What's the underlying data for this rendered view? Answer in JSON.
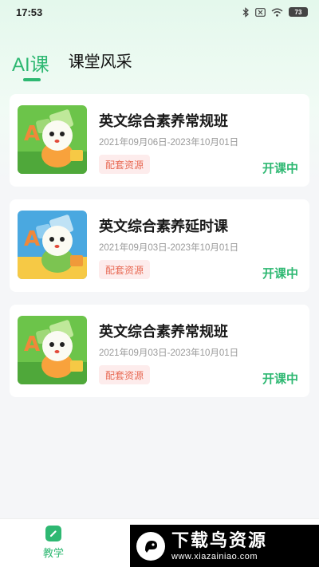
{
  "status_bar": {
    "time": "17:53",
    "battery": "73"
  },
  "tabs": [
    {
      "label": "AI课",
      "active": true
    },
    {
      "label": "课堂风采",
      "active": false
    }
  ],
  "courses": [
    {
      "title": "英文综合素养常规班",
      "date_range": "2021年09月06日-2023年10月01日",
      "resource_label": "配套资源",
      "status": "开课中",
      "thumb_color": "#6cc44a"
    },
    {
      "title": "英文综合素养延时课",
      "date_range": "2021年09月03日-2023年10月01日",
      "resource_label": "配套资源",
      "status": "开课中",
      "thumb_color": "#4aa8e0"
    },
    {
      "title": "英文综合素养常规班",
      "date_range": "2021年09月03日-2023年10月01日",
      "resource_label": "配套资源",
      "status": "开课中",
      "thumb_color": "#6cc44a"
    }
  ],
  "bottom_nav": {
    "items": [
      {
        "label": "教学",
        "active": true
      }
    ]
  },
  "watermark": {
    "title": "下载鸟资源",
    "url": "www.xiazainiao.com"
  },
  "colors": {
    "accent": "#2eb872",
    "badge_text": "#e86a54",
    "badge_bg": "#fdecec"
  }
}
